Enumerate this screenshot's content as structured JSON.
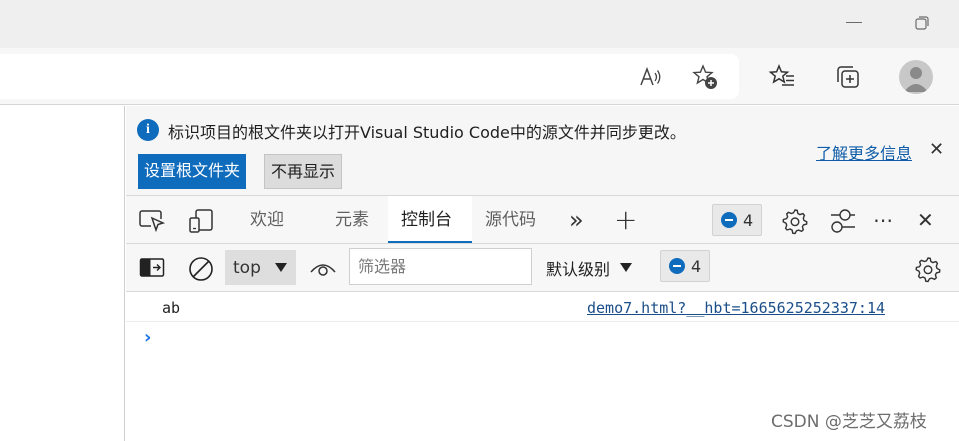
{
  "infobar": {
    "message": "标识项目的根文件夹以打开Visual Studio Code中的源文件并同步更改。",
    "set_root_button": "设置根文件夹",
    "dont_show_button": "不再显示",
    "learn_more_link": "了解更多信息",
    "close_glyph": "✕"
  },
  "tabs": [
    {
      "label": "欢迎"
    },
    {
      "label": "元素"
    },
    {
      "label": "控制台"
    },
    {
      "label": "源代码"
    }
  ],
  "tabbar": {
    "more_tabs_glyph": "»",
    "add_tab_glyph": "+",
    "issues_count": "4",
    "more_glyph": "⋯",
    "close_glyph": "✕"
  },
  "toolbar": {
    "context": "top",
    "filter_placeholder": "筛选器",
    "levels": "默认级别",
    "issues_count": "4"
  },
  "console": {
    "messages": [
      {
        "text": "ab",
        "source": "demo7.html?__hbt=1665625252337:14"
      }
    ],
    "prompt_glyph": "›"
  },
  "watermark": "CSDN @芝芝又荔枝",
  "colors": {
    "accent": "#0f6cbd",
    "link": "#1a4e8a"
  },
  "icons": [
    "minimize-icon",
    "restore-icon",
    "read-aloud-icon",
    "add-favorite-icon",
    "favorites-icon",
    "collections-icon",
    "profile-avatar-icon",
    "info-icon",
    "inspect-icon",
    "device-emulation-icon",
    "gear-icon",
    "customize-icon",
    "sidebar-toggle-icon",
    "clear-console-icon",
    "eye-icon"
  ]
}
